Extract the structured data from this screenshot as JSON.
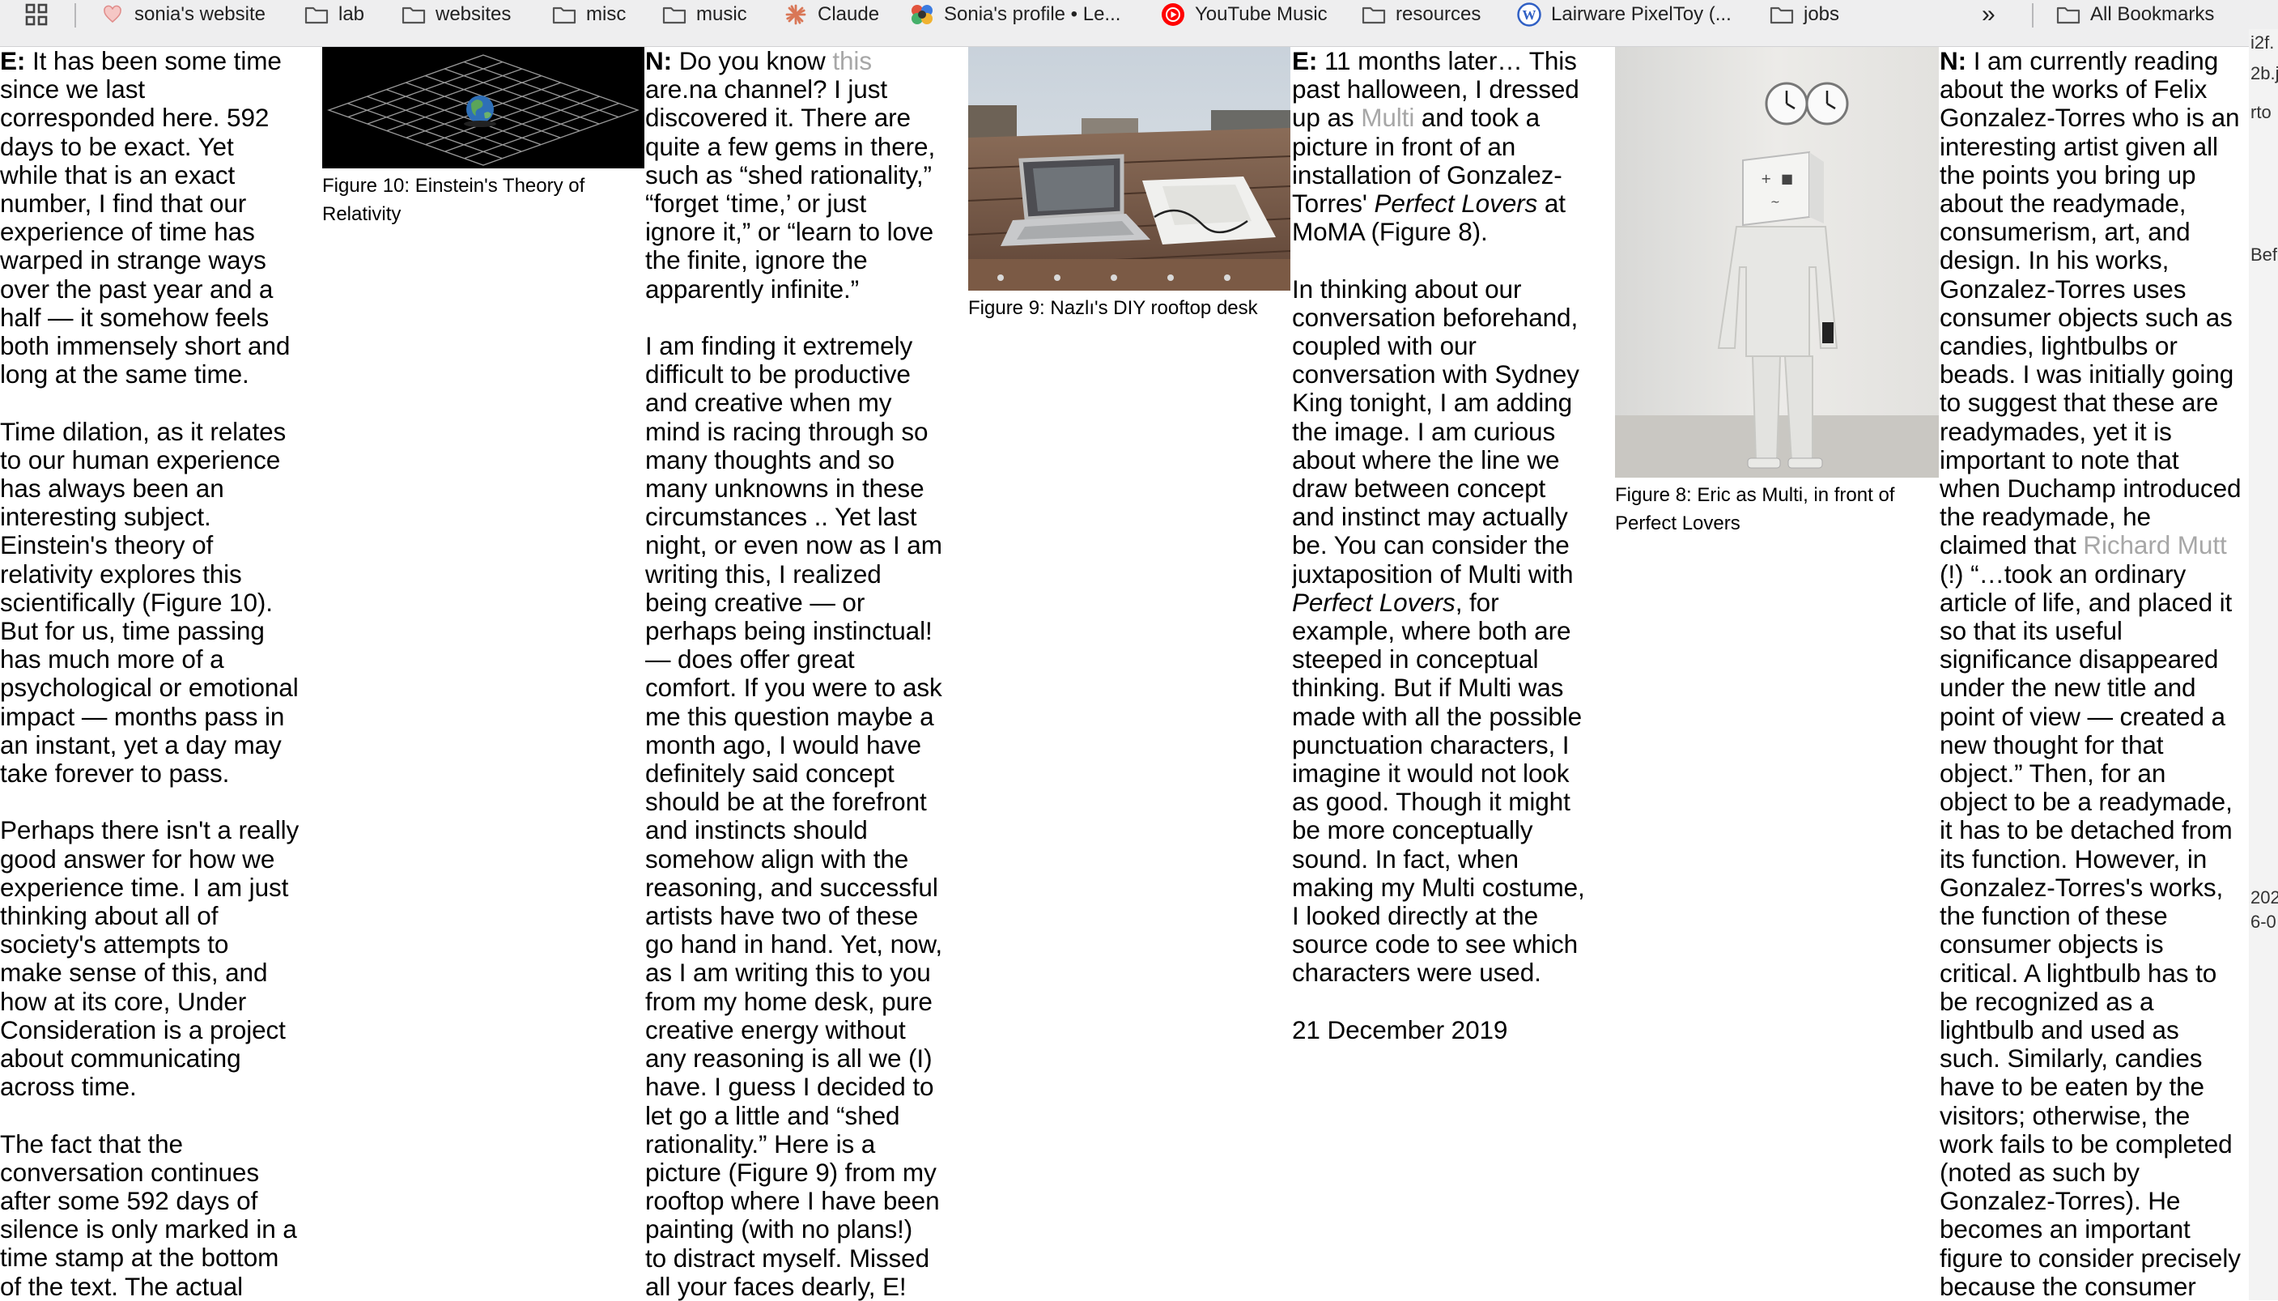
{
  "bookmarks": {
    "items": [
      {
        "label": "sonia's website",
        "icon": "heart-icon"
      },
      {
        "label": "lab",
        "icon": "folder-icon"
      },
      {
        "label": "websites",
        "icon": "folder-icon"
      },
      {
        "label": "misc",
        "icon": "folder-icon"
      },
      {
        "label": "music",
        "icon": "folder-icon"
      },
      {
        "label": "Claude",
        "icon": "claude-icon"
      },
      {
        "label": "Sonia's profile • Le...",
        "icon": "profile-icon"
      },
      {
        "label": "YouTube Music",
        "icon": "youtube-music-icon"
      },
      {
        "label": "resources",
        "icon": "folder-icon"
      },
      {
        "label": "Lairware PixelToy (...",
        "icon": "wordpress-icon"
      },
      {
        "label": "jobs",
        "icon": "folder-icon"
      }
    ],
    "overflow_label": "»",
    "all_bookmarks": "All Bookmarks"
  },
  "col1": {
    "p1": [
      "E:",
      " It has been some time",
      "since we last",
      "corresponded here. 592",
      "days to be exact. Yet",
      "while that is an exact",
      "number, I find that our",
      "experience of time has",
      "warped in strange ways",
      "over the past year and a",
      "half — it somehow feels",
      "both immensely short and",
      "long at the same time."
    ],
    "p2": [
      "Time dilation, as it relates",
      "to our human experience",
      "has always been an",
      "interesting subject.",
      "Einstein's theory of",
      "relativity explores this",
      "scientifically (Figure 10).",
      "But for us, time passing",
      "has much more of a",
      "psychological or emotional",
      "impact — months pass in",
      "an instant, yet a day may",
      "take forever to pass."
    ],
    "p3": [
      "Perhaps there isn't a really",
      "good answer for how we",
      "experience time. I am just",
      "thinking about all of",
      "society's attempts to",
      "make sense of this, and",
      "how at its core, Under",
      "Consideration is a project",
      "about communicating",
      "across time."
    ],
    "p4": [
      "The fact that the",
      "conversation continues",
      "after some 592 days of",
      "silence is only marked in a",
      "time stamp at the bottom",
      "of the text. The actual"
    ]
  },
  "fig10": {
    "caption": [
      "Figure 10: Einstein's Theory of",
      "Relativity"
    ]
  },
  "col2": {
    "p1_lead": "N:",
    "p1_a": " Do you know ",
    "p1_link": "this",
    "p1": [
      "are.na channel? I just",
      "discovered it. There are",
      "quite a few gems in there,",
      "such as “shed rationality,”",
      "“forget ‘time,’ or just",
      "ignore it,” or “learn to love",
      "the finite, ignore the",
      "apparently infinite.”"
    ],
    "p2": [
      "I am finding it extremely",
      "difficult to be productive",
      "and creative when my",
      "mind is racing through so",
      "many thoughts and so",
      "many unknowns in these",
      "circumstances .. Yet last",
      "night, or even now as I am",
      "writing this, I realized",
      "being creative — or",
      "perhaps being instinctual!",
      "— does offer great",
      "comfort. If you were to ask",
      "me this question maybe a",
      "month ago, I would have",
      "definitely said concept",
      "should be at the forefront",
      "and instincts should",
      "somehow align with the",
      "reasoning, and successful",
      "artists have two of these",
      "go hand in hand. Yet, now,",
      "as I am writing this to you",
      "from my home desk, pure",
      "creative energy without",
      "any reasoning is all we (I)",
      "have. I guess I decided to",
      "let go a little and “shed",
      "rationality.” Here is a",
      "picture (Figure 9) from my",
      "rooftop where I have been",
      "painting (with no plans!)",
      "to distract myself. Missed",
      "all your faces dearly, E!"
    ]
  },
  "fig9": {
    "caption": "Figure 9: Nazlı's DIY rooftop desk"
  },
  "col3": {
    "p1_lead": "E:",
    "p1_a": " 11 months later… This",
    "p1_b": "past halloween, I dressed",
    "p1_c": "up as ",
    "p1_link": "Multi",
    "p1_d": " and took a",
    "p1_e": "picture in front of an",
    "p1_f": "installation of Gonzalez-",
    "p1_g": "Torres' ",
    "p1_italic": "Perfect Lovers",
    "p1_h": " at",
    "p1_i": "MoMA (Figure 8).",
    "p2_a": [
      "In thinking about our",
      "conversation beforehand,",
      "coupled with our",
      "conversation with Sydney",
      "King tonight, I am adding",
      "the image. I am curious",
      "about where the line we",
      "draw between concept",
      "and instinct may actually",
      "be. You can consider the",
      "juxtaposition of Multi with"
    ],
    "p2_italic": "Perfect Lovers",
    "p2_after": ", for",
    "p2_b": [
      "example, where both are",
      "steeped in conceptual",
      "thinking. But if Multi was",
      "made with all the possible",
      "punctuation characters, I",
      "imagine it would not look",
      "as good. Though it might",
      "be more conceptually",
      "sound. In fact, when",
      "making my Multi costume,",
      "I looked directly at the",
      "source code to see which",
      "characters were used."
    ],
    "date": "21 December 2019"
  },
  "fig8": {
    "caption": [
      "Figure 8: Eric as Multi, in front of",
      "Perfect Lovers"
    ]
  },
  "col4": {
    "p1_lead": "N:",
    "p1_a": " I am currently reading",
    "p1": [
      "about the works of Felix",
      "Gonzalez-Torres who is an",
      "interesting artist given all",
      "the points you bring up",
      "about the readymade,",
      "consumerism, art, and",
      "design. In his works,",
      "Gonzalez-Torres uses",
      "consumer objects such as",
      "candies, lightbulbs or",
      "beads. I was initially going",
      "to suggest that these are",
      "readymades, yet it is",
      "important to note that",
      "when Duchamp introduced",
      "the readymade, he"
    ],
    "p1_c": "claimed that ",
    "p1_link": "Richard Mutt",
    "p2": [
      "(!) “…took an ordinary",
      "article of life, and placed it",
      "so that its useful",
      "significance disappeared",
      "under the new title and",
      "point of view — created a",
      "new thought for that",
      "object.” Then, for an",
      "object to be a readymade,",
      "it has to be detached from",
      "its function. However, in",
      "Gonzalez-Torres's works,",
      "the function of these",
      "consumer objects is",
      "critical. A lightbulb has to",
      "be recognized as a",
      "lightbulb and used as",
      "such. Similarly, candies",
      "have to be eaten by the",
      "visitors; otherwise, the",
      "work fails to be completed",
      "(noted as such by",
      "Gonzalez-Torres). He",
      "becomes an important",
      "figure to consider precisely",
      "because the consumer"
    ]
  },
  "edge": {
    "texts": [
      "i2f.",
      "2b.j",
      "rto",
      "Bef.",
      "202",
      "6-0"
    ]
  }
}
